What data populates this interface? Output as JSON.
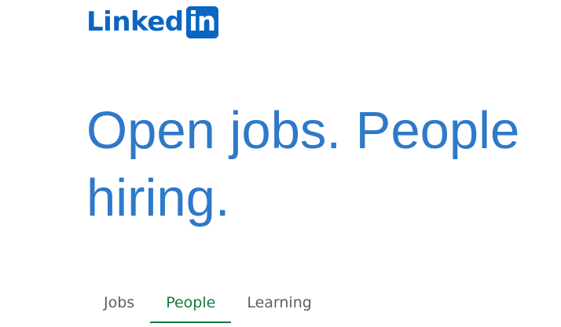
{
  "brand": {
    "wordmark": "Linked",
    "badge": "in",
    "color": "#0a66c2",
    "icon": "linkedin-logo"
  },
  "hero": {
    "title": "Open jobs. People hiring.",
    "color": "#2e79c9"
  },
  "tabs": [
    {
      "label": "Jobs",
      "active": false
    },
    {
      "label": "People",
      "active": true
    },
    {
      "label": "Learning",
      "active": false
    }
  ],
  "colors": {
    "active_tab": "#157a3c",
    "inactive_tab": "#5e5e5e"
  }
}
